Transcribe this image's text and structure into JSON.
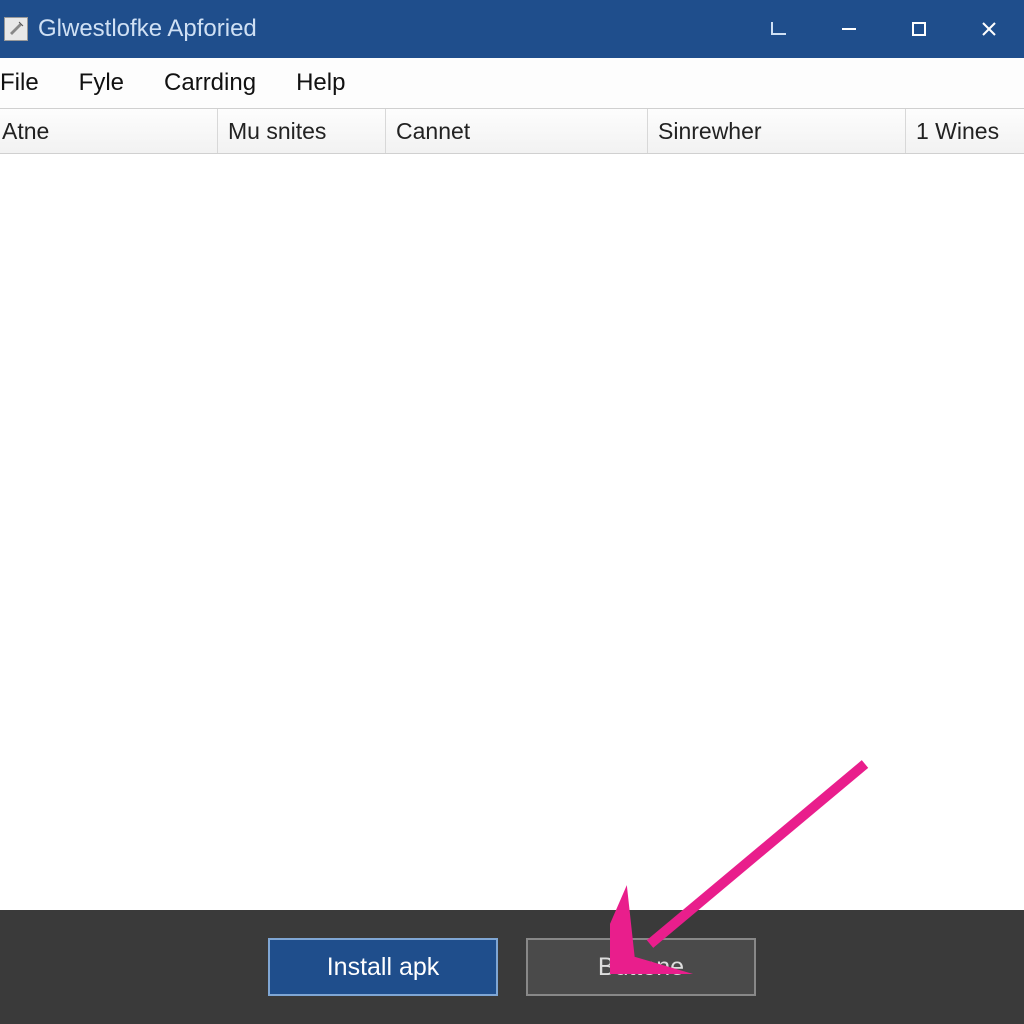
{
  "titlebar": {
    "title": "Glwestlofke Apforied"
  },
  "menubar": {
    "items": [
      "File",
      "Fyle",
      "Carrding",
      "Help"
    ]
  },
  "columns": [
    "Atne",
    "Mu snites",
    "Cannet",
    "Sinrewher",
    "1 Wines"
  ],
  "bottombar": {
    "primary_label": "Install apk",
    "secondary_label": "Buttone"
  }
}
